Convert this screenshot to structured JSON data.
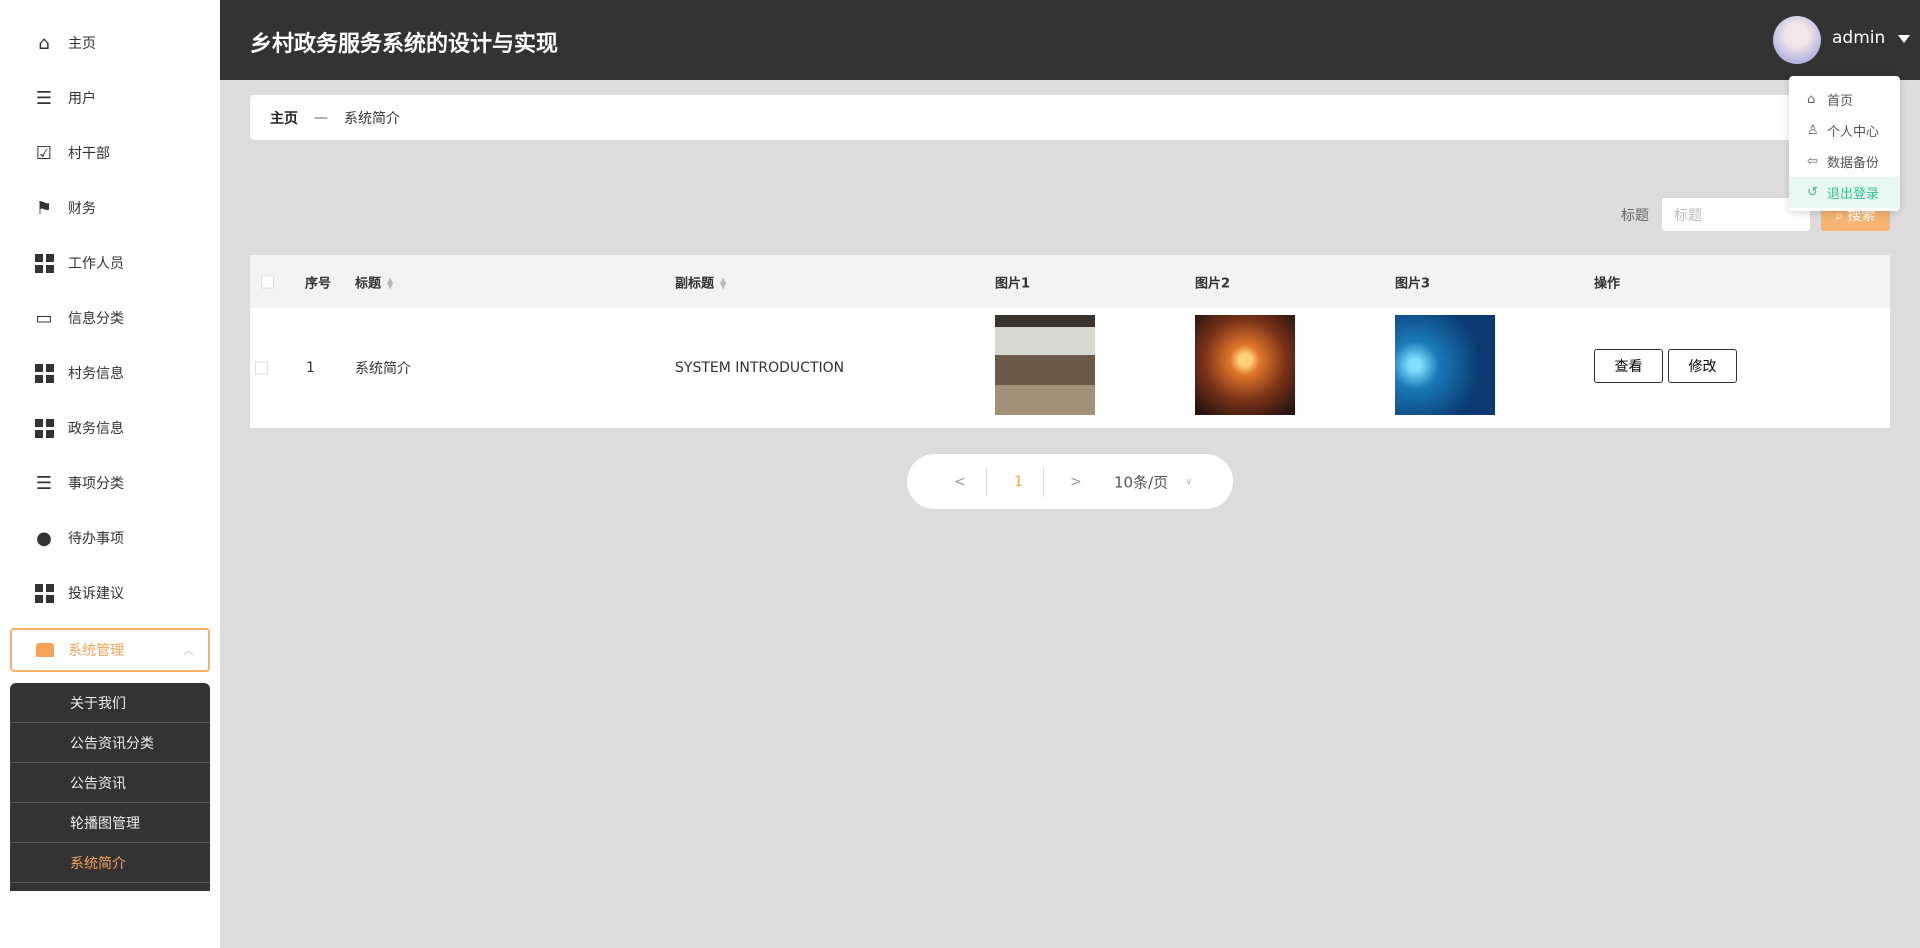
{
  "header": {
    "title": "乡村政务服务系统的设计与实现",
    "username": "admin"
  },
  "user_menu": [
    {
      "icon": "home-icon",
      "label": "首页"
    },
    {
      "icon": "user-icon",
      "label": "个人中心"
    },
    {
      "icon": "arrow-left-icon",
      "label": "数据备份"
    },
    {
      "icon": "logout-icon",
      "label": "退出登录"
    }
  ],
  "sidebar": {
    "items": [
      {
        "label": "主页",
        "icon": "home-icon"
      },
      {
        "label": "用户",
        "icon": "list-icon"
      },
      {
        "label": "村干部",
        "icon": "clipboard-check-icon"
      },
      {
        "label": "财务",
        "icon": "flag-icon"
      },
      {
        "label": "工作人员",
        "icon": "grid-icon"
      },
      {
        "label": "信息分类",
        "icon": "monitor-icon"
      },
      {
        "label": "村务信息",
        "icon": "grid-icon"
      },
      {
        "label": "政务信息",
        "icon": "grid-icon"
      },
      {
        "label": "事项分类",
        "icon": "list-icon"
      },
      {
        "label": "待办事项",
        "icon": "person-icon"
      },
      {
        "label": "投诉建议",
        "icon": "grid-icon"
      }
    ],
    "active_group": {
      "label": "系统管理",
      "icon": "store-icon"
    },
    "subitems": [
      "关于我们",
      "公告资讯分类",
      "公告资讯",
      "轮播图管理",
      "系统简介"
    ],
    "active_subitem": "系统简介",
    "accent": "#f5a25a"
  },
  "breadcrumb": {
    "home": "主页",
    "separator": "—",
    "current": "系统简介"
  },
  "search": {
    "label": "标题",
    "placeholder": "标题",
    "button": "搜索"
  },
  "table": {
    "headers": [
      "序号",
      "标题",
      "副标题",
      "图片1",
      "图片2",
      "图片3",
      "操作"
    ],
    "rows": [
      {
        "index": "1",
        "title": "系统简介",
        "subtitle": "SYSTEM INTRODUCTION",
        "view": "查看",
        "edit": "修改"
      }
    ]
  },
  "pagination": {
    "prev": "<",
    "current": "1",
    "next": ">",
    "page_size": "10条/页"
  }
}
